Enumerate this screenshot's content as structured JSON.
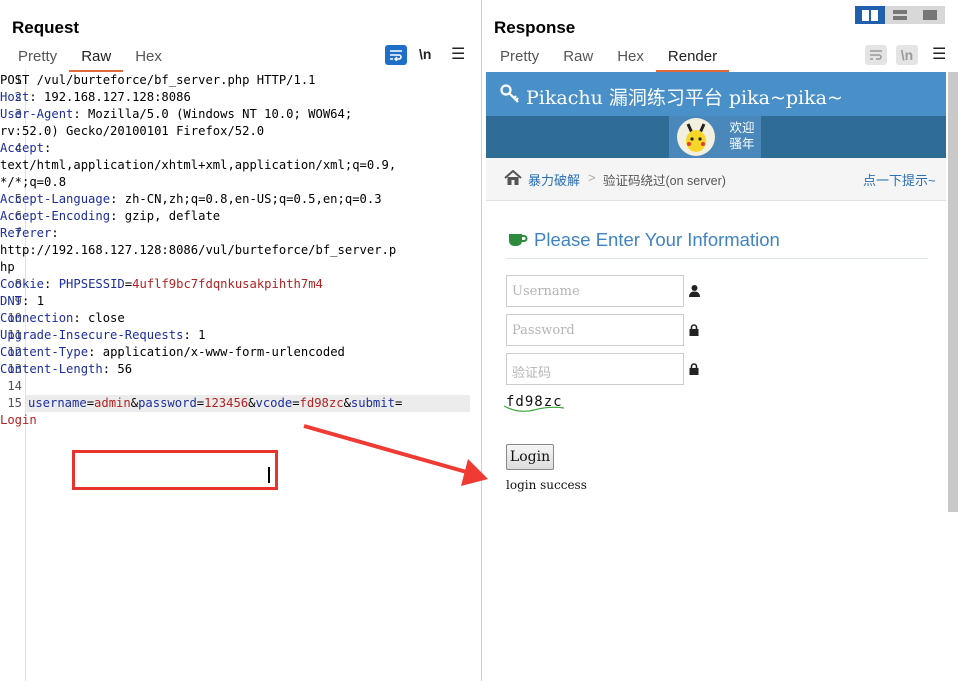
{
  "request": {
    "title": "Request",
    "tabs": [
      "Pretty",
      "Raw",
      "Hex"
    ],
    "active_tab": "Raw",
    "toolbar": {
      "wrap_icon": "wrap-lines-icon",
      "newline_label": "\\n",
      "menu_icon": "hamburger-menu-icon"
    },
    "lines": [
      {
        "n": "1",
        "parts": [
          {
            "t": "POST /vul/burteforce/bf_server.php HTTP/1.1",
            "c": "v"
          }
        ]
      },
      {
        "n": "2",
        "parts": [
          {
            "t": "Host",
            "c": "k"
          },
          {
            "t": ": 192.168.127.128:8086",
            "c": "v"
          }
        ]
      },
      {
        "n": "3",
        "parts": [
          {
            "t": "User-Agent",
            "c": "k"
          },
          {
            "t": ": Mozilla/5.0 (Windows NT 10.0; WOW64;",
            "c": "v"
          }
        ]
      },
      {
        "n": "",
        "parts": [
          {
            "t": "rv:52.0) Gecko/20100101 Firefox/52.0",
            "c": "v"
          }
        ]
      },
      {
        "n": "4",
        "parts": [
          {
            "t": "Accept",
            "c": "k"
          },
          {
            "t": ":",
            "c": "v"
          }
        ]
      },
      {
        "n": "",
        "parts": [
          {
            "t": "text/html,application/xhtml+xml,application/xml;q=0.9,",
            "c": "v"
          }
        ]
      },
      {
        "n": "",
        "parts": [
          {
            "t": "*/*;q=0.8",
            "c": "v"
          }
        ]
      },
      {
        "n": "5",
        "parts": [
          {
            "t": "Accept-Language",
            "c": "k"
          },
          {
            "t": ": zh-CN,zh;q=0.8,en-US;q=0.5,en;q=0.3",
            "c": "v"
          }
        ]
      },
      {
        "n": "6",
        "parts": [
          {
            "t": "Accept-Encoding",
            "c": "k"
          },
          {
            "t": ": gzip, deflate",
            "c": "v"
          }
        ]
      },
      {
        "n": "7",
        "parts": [
          {
            "t": "Referer",
            "c": "k"
          },
          {
            "t": ":",
            "c": "v"
          }
        ]
      },
      {
        "n": "",
        "parts": [
          {
            "t": "http://192.168.127.128:8086/vul/burteforce/bf_server.p",
            "c": "v"
          }
        ]
      },
      {
        "n": "",
        "parts": [
          {
            "t": "hp",
            "c": "v"
          }
        ]
      },
      {
        "n": "8",
        "parts": [
          {
            "t": "Cookie",
            "c": "k"
          },
          {
            "t": ": ",
            "c": "v"
          },
          {
            "t": "PHPSESSID",
            "c": "k"
          },
          {
            "t": "=",
            "c": "v"
          },
          {
            "t": "4uflf9bc7fdqnkusakpihth7m4",
            "c": "cv"
          }
        ]
      },
      {
        "n": "9",
        "parts": [
          {
            "t": "DNT",
            "c": "k"
          },
          {
            "t": ": 1",
            "c": "v"
          }
        ]
      },
      {
        "n": "10",
        "parts": [
          {
            "t": "Connection",
            "c": "k"
          },
          {
            "t": ": close",
            "c": "v"
          }
        ]
      },
      {
        "n": "11",
        "parts": [
          {
            "t": "Upgrade-Insecure-Requests",
            "c": "k"
          },
          {
            "t": ": 1",
            "c": "v"
          }
        ]
      },
      {
        "n": "12",
        "parts": [
          {
            "t": "Content-Type",
            "c": "k"
          },
          {
            "t": ": application/x-www-form-urlencoded",
            "c": "v"
          }
        ]
      },
      {
        "n": "13",
        "parts": [
          {
            "t": "Content-Length",
            "c": "k"
          },
          {
            "t": ": 56",
            "c": "v"
          }
        ]
      },
      {
        "n": "14",
        "parts": []
      },
      {
        "n": "15",
        "hl": true,
        "parts": [
          {
            "t": "username",
            "c": "pk"
          },
          {
            "t": "=",
            "c": "v"
          },
          {
            "t": "admin",
            "c": "pv"
          },
          {
            "t": "&",
            "c": "v"
          },
          {
            "t": "password",
            "c": "pk"
          },
          {
            "t": "=",
            "c": "v"
          },
          {
            "t": "123456",
            "c": "pv"
          },
          {
            "t": "&",
            "c": "v"
          },
          {
            "t": "vcode",
            "c": "pk"
          },
          {
            "t": "=",
            "c": "v"
          },
          {
            "t": "fd98zc",
            "c": "pv"
          },
          {
            "t": "&",
            "c": "v"
          },
          {
            "t": "submit",
            "c": "pk"
          },
          {
            "t": "=",
            "c": "v"
          }
        ]
      },
      {
        "n": "",
        "parts": [
          {
            "t": "Login",
            "c": "pv"
          }
        ]
      }
    ]
  },
  "response": {
    "title": "Response",
    "tabs": [
      "Pretty",
      "Raw",
      "Hex",
      "Render"
    ],
    "active_tab": "Render",
    "toolbar": {
      "newline_label": "\\n"
    },
    "page": {
      "header_title": "Pikachu 漏洞练习平台 pika~pika~",
      "user_line1": "欢迎",
      "user_line2": "骚年",
      "breadcrumb_home": "暴力破解",
      "breadcrumb_sep": ">",
      "breadcrumb_current": "验证码绕过(on server)",
      "hint": "点一下提示~",
      "form_title": "Please Enter Your Information",
      "username_placeholder": "Username",
      "password_placeholder": "Password",
      "vcode_placeholder": "验证码",
      "captcha_text": "fd98zc",
      "login_button": "Login",
      "result_message": "login success"
    }
  },
  "colors": {
    "accent": "#1f6fc9",
    "header": "#4a90c8",
    "highlight": "#e8322c"
  }
}
